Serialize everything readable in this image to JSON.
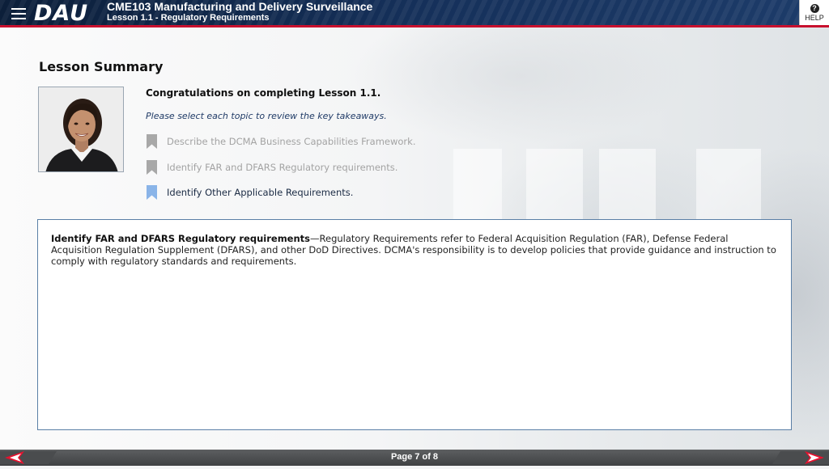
{
  "header": {
    "logo": "DAU",
    "course_title": "CME103 Manufacturing and Delivery Surveillance",
    "lesson_title": "Lesson 1.1 - Regulatory Requirements",
    "help_label": "HELP",
    "help_icon": "question-icon",
    "menu_icon": "hamburger-menu-icon",
    "accent_color": "#c8102e"
  },
  "content": {
    "title": "Lesson Summary",
    "congrats": "Congratulations on completing Lesson 1.1.",
    "instruction": "Please select each topic to review the key takeaways.",
    "topics": [
      {
        "label": "Describe the DCMA Business Capabilities Framework.",
        "state": "visited",
        "icon": "bookmark-icon"
      },
      {
        "label": "Identify FAR and DFARS Regulatory requirements.",
        "state": "visited",
        "icon": "bookmark-icon"
      },
      {
        "label": "Identify Other Applicable Requirements.",
        "state": "current",
        "icon": "bookmark-icon"
      }
    ],
    "detail": {
      "heading": "Identify FAR and DFARS Regulatory requirements",
      "separator": "—",
      "body": "Regulatory Requirements refer to Federal Acquisition Regulation (FAR), Defense Federal Acquisition Regulation Supplement (DFARS), and other DoD Directives. DCMA's responsibility is to develop policies that provide guidance and instruction to comply with regulatory standards and requirements."
    }
  },
  "footer": {
    "page_text": "Page 7 of 8",
    "prev_icon": "arrow-left-icon",
    "next_icon": "arrow-right-icon",
    "arrow_color": "#e8102e"
  }
}
